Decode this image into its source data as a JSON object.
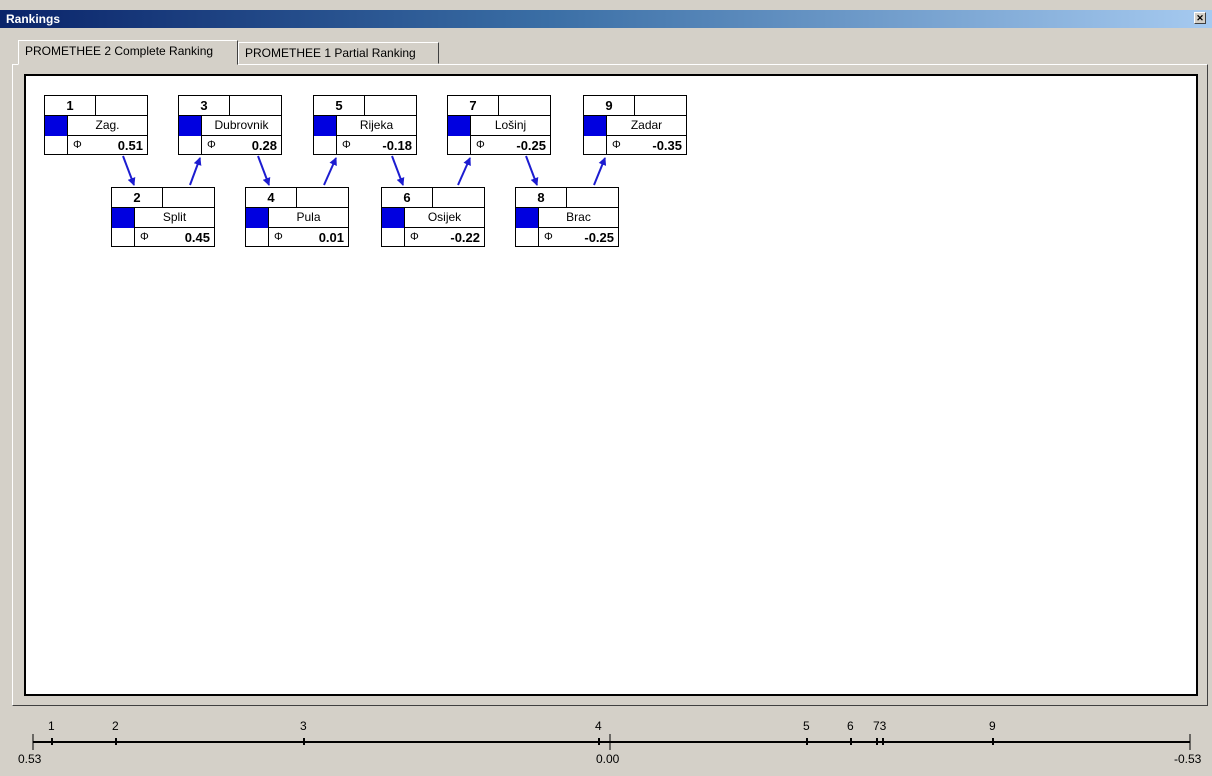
{
  "window": {
    "title": "Rankings",
    "close_icon": "close-icon"
  },
  "tabs": [
    {
      "label": "PROMETHEE 2 Complete Ranking",
      "active": true
    },
    {
      "label": "PROMETHEE 1 Partial Ranking",
      "active": false
    }
  ],
  "phi_symbol": "Φ",
  "nodes": [
    {
      "rank": "1",
      "name": "Zag.",
      "score": "0.51"
    },
    {
      "rank": "2",
      "name": "Split",
      "score": "0.45"
    },
    {
      "rank": "3",
      "name": "Dubrovnik",
      "score": "0.28"
    },
    {
      "rank": "4",
      "name": "Pula",
      "score": "0.01"
    },
    {
      "rank": "5",
      "name": "Rijeka",
      "score": "-0.18"
    },
    {
      "rank": "6",
      "name": "Osijek",
      "score": "-0.22"
    },
    {
      "rank": "7",
      "name": "Lošinj",
      "score": "-0.25"
    },
    {
      "rank": "8",
      "name": "Brac",
      "score": "-0.25"
    },
    {
      "rank": "9",
      "name": "Zadar",
      "score": "-0.35"
    }
  ],
  "axis": {
    "left_label": "0.53",
    "center_label": "0.00",
    "right_label": "-0.53",
    "tick_labels": [
      "1",
      "2",
      "3",
      "4",
      "5",
      "6",
      "73",
      "9"
    ]
  },
  "colors": {
    "node_color": "#0000e0",
    "arrow_color": "#1c1cd0"
  }
}
